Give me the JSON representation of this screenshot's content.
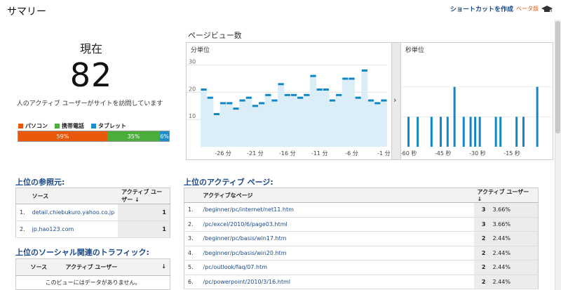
{
  "header": {
    "title": "サマリー",
    "shortcut_label": "ショートカットを作成",
    "beta_label": "ベータ版"
  },
  "now": {
    "label": "現在",
    "value": "82",
    "description": "人のアクティブ ユーザーがサイトを訪問しています"
  },
  "devices": [
    {
      "label": "パソコン",
      "percent": "59%",
      "share": 59,
      "color": "#e8590c"
    },
    {
      "label": "携帯電話",
      "percent": "35%",
      "share": 35,
      "color": "#4cae3a"
    },
    {
      "label": "タブレット",
      "percent": "6%",
      "share": 6,
      "color": "#1b8fc9"
    }
  ],
  "pageviews": {
    "title": "ページビュー数",
    "per_minute_label": "分単位",
    "per_second_label": "秒単位"
  },
  "chart_data": [
    {
      "type": "line",
      "title": "分単位",
      "x": [
        -29,
        -28,
        -27,
        -26,
        -25,
        -24,
        -23,
        -22,
        -21,
        -20,
        -19,
        -18,
        -17,
        -16,
        -15,
        -14,
        -13,
        -12,
        -11,
        -10,
        -9,
        -8,
        -7,
        -6,
        -5,
        -4,
        -3,
        -2,
        -1
      ],
      "values": [
        21,
        18,
        12,
        16,
        16,
        14,
        17,
        18,
        15,
        16,
        19,
        17,
        23,
        19,
        19,
        18,
        19,
        26,
        21,
        21,
        17,
        19,
        25,
        25,
        18,
        28,
        17,
        16,
        17
      ],
      "x_tick_labels": [
        "-26 分",
        "-21 分",
        "-16 分",
        "-11 分",
        "-6 分",
        "-1 分"
      ],
      "y_tick_labels": [
        "30",
        "20",
        "10"
      ],
      "ylim": [
        0,
        33
      ],
      "color": "#0f87c5"
    },
    {
      "type": "bar",
      "title": "秒単位",
      "x": [
        -60,
        -56,
        -50,
        -46,
        -43,
        -40,
        -36,
        -33,
        -31,
        -29,
        -22,
        -20,
        -13,
        -10,
        -4
      ],
      "values": [
        1,
        1,
        1,
        1,
        1,
        2,
        1,
        1,
        1,
        1,
        1,
        1,
        1,
        1,
        2
      ],
      "x_tick_labels": [
        "-60 秒",
        "-45 秒",
        "-30 秒",
        "-15 秒"
      ],
      "ylim": [
        0,
        3
      ],
      "color": "#0f87c5"
    }
  ],
  "referrals": {
    "title": "上位の参照元:",
    "col_source": "ソース",
    "col_users": "アクティブ ユーザー",
    "rows": [
      {
        "idx": "1.",
        "source": "detail.chiebukuro.yahoo.co.jp",
        "users": "1"
      },
      {
        "idx": "2.",
        "source": "jp.hao123.com",
        "users": "1"
      }
    ]
  },
  "social": {
    "title": "上位のソーシャル関連のトラフィック:",
    "col_source": "ソース",
    "col_users": "アクティブ ユーザー",
    "empty": "このビューにはデータがありません。"
  },
  "active_pages": {
    "title": "上位のアクティブ ページ:",
    "col_page": "アクティブなページ",
    "col_users": "アクティブ ユーザー",
    "rows": [
      {
        "idx": "1.",
        "page": "/beginner/pc/internet/net11.htm",
        "users": "3",
        "pct": "3.66%"
      },
      {
        "idx": "2.",
        "page": "/pc/excel/2010/6/page03.html",
        "users": "3",
        "pct": "3.66%"
      },
      {
        "idx": "3.",
        "page": "/beginner/pc/basis/win17.htm",
        "users": "2",
        "pct": "2.44%"
      },
      {
        "idx": "4.",
        "page": "/beginner/pc/basis/win20.htm",
        "users": "2",
        "pct": "2.44%"
      },
      {
        "idx": "5.",
        "page": "/pc/outlook/faq/07.htm",
        "users": "2",
        "pct": "2.44%"
      },
      {
        "idx": "6.",
        "page": "/pc/powerpoint/2010/3/16.html",
        "users": "2",
        "pct": "2.44%"
      }
    ]
  }
}
